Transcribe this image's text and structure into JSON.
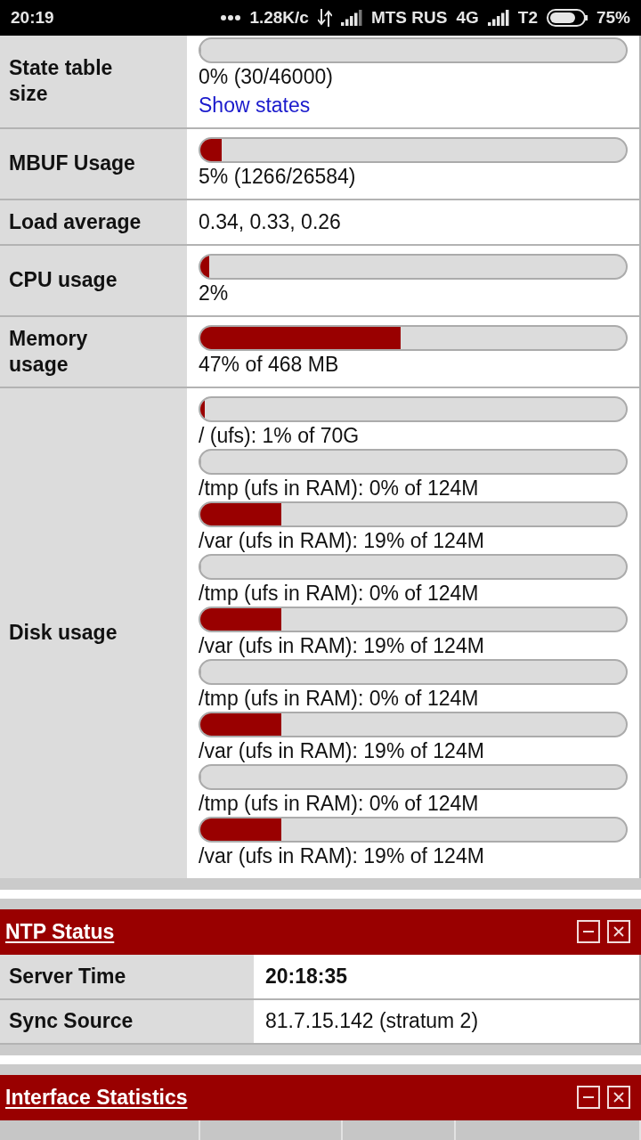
{
  "status_bar": {
    "time": "20:19",
    "net_speed": "1.28K/c",
    "carrier": "MTS RUS",
    "network_type": "4G",
    "sim_label": "T2",
    "battery": "75%"
  },
  "system_info": {
    "rows": [
      {
        "label": "State table size",
        "kind": "meters",
        "meters": [
          {
            "level": 0,
            "reading": "0% (30/46000)"
          }
        ],
        "link": "Show states"
      },
      {
        "label": "MBUF Usage",
        "kind": "meters",
        "meters": [
          {
            "level": 0.05,
            "reading": "5% (1266/26584)"
          }
        ]
      },
      {
        "label": "Load average",
        "kind": "text",
        "value": "0.34, 0.33, 0.26"
      },
      {
        "label": "CPU usage",
        "kind": "meters",
        "meters": [
          {
            "level": 0.02,
            "reading": "2%"
          }
        ]
      },
      {
        "label": "Memory usage",
        "kind": "meters",
        "meters": [
          {
            "level": 0.47,
            "reading": "47% of 468 MB"
          }
        ]
      },
      {
        "label": "Disk usage",
        "kind": "meters",
        "meters": [
          {
            "level": 0.01,
            "reading": "/ (ufs): 1% of 70G"
          },
          {
            "level": 0,
            "reading": "/tmp (ufs in RAM): 0% of 124M"
          },
          {
            "level": 0.19,
            "reading": "/var (ufs in RAM): 19% of 124M"
          },
          {
            "level": 0,
            "reading": "/tmp (ufs in RAM): 0% of 124M"
          },
          {
            "level": 0.19,
            "reading": "/var (ufs in RAM): 19% of 124M"
          },
          {
            "level": 0,
            "reading": "/tmp (ufs in RAM): 0% of 124M"
          },
          {
            "level": 0.19,
            "reading": "/var (ufs in RAM): 19% of 124M"
          },
          {
            "level": 0,
            "reading": "/tmp (ufs in RAM): 0% of 124M"
          },
          {
            "level": 0.19,
            "reading": "/var (ufs in RAM): 19% of 124M"
          }
        ]
      }
    ]
  },
  "ntp_status": {
    "title": "NTP Status",
    "rows": [
      {
        "label": "Server Time",
        "value": "20:18:35",
        "bold": true
      },
      {
        "label": "Sync Source",
        "value": "81.7.15.142 (stratum 2)",
        "bold": false
      }
    ]
  },
  "interface_statistics": {
    "title": "Interface Statistics"
  }
}
